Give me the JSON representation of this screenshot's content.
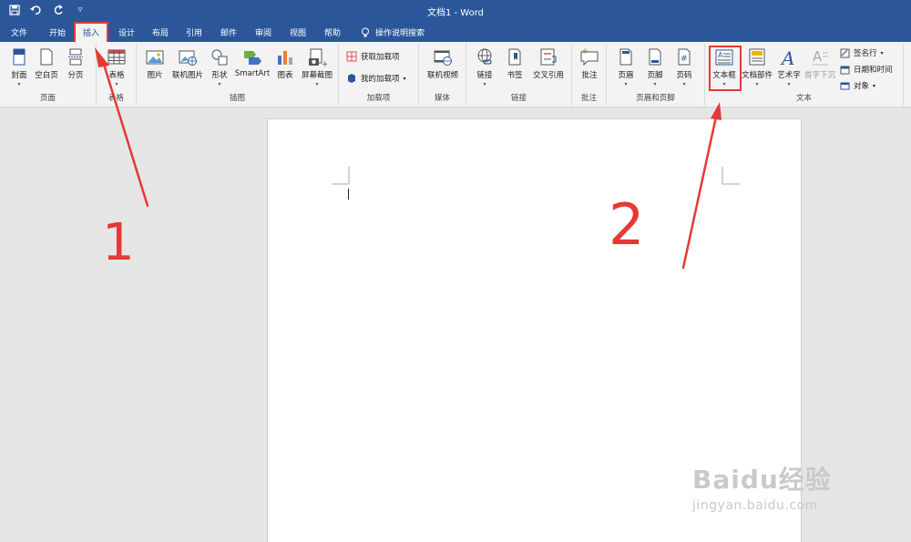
{
  "window": {
    "title": "文档1  -  Word"
  },
  "qat": {
    "save": "save-icon",
    "undo": "undo-icon",
    "redo": "redo-icon",
    "customize": "▿"
  },
  "tabs": [
    "文件",
    "开始",
    "插入",
    "设计",
    "布局",
    "引用",
    "邮件",
    "审阅",
    "视图",
    "帮助"
  ],
  "tell_me": "操作说明搜索",
  "ribbon": {
    "pages": {
      "label": "页面",
      "cover": "封面",
      "blank": "空白页",
      "break": "分页"
    },
    "tables": {
      "label": "表格",
      "table": "表格"
    },
    "illustrations": {
      "label": "插图",
      "pictures": "图片",
      "online_pictures": "联机图片",
      "shapes": "形状",
      "smartart": "SmartArt",
      "chart": "图表",
      "screenshot": "屏幕截图"
    },
    "addins": {
      "label": "加载项",
      "get": "获取加载项",
      "mine": "我的加载项"
    },
    "media": {
      "label": "媒体",
      "online_video": "联机视频"
    },
    "links": {
      "label": "链接",
      "link": "链接",
      "bookmark": "书签",
      "cross_ref": "交叉引用"
    },
    "comments": {
      "label": "批注",
      "comment": "批注"
    },
    "header_footer": {
      "label": "页眉和页脚",
      "header": "页眉",
      "footer": "页脚",
      "page_number": "页码"
    },
    "text": {
      "label": "文本",
      "textbox": "文本框",
      "quick_parts": "文档部件",
      "wordart": "艺术字",
      "dropcap": "首字下沉",
      "signature": "签名行",
      "datetime": "日期和时间",
      "object": "对象"
    }
  },
  "annotations": {
    "step1": "1",
    "step2": "2"
  },
  "watermark": {
    "main": "Baidu经验",
    "sub": "jingyan.baidu.com"
  },
  "colors": {
    "title_bg": "#2b579a",
    "ribbon_bg": "#f3f3f3",
    "canvas_bg": "#e6e6e6",
    "annotation_red": "#e53935"
  }
}
